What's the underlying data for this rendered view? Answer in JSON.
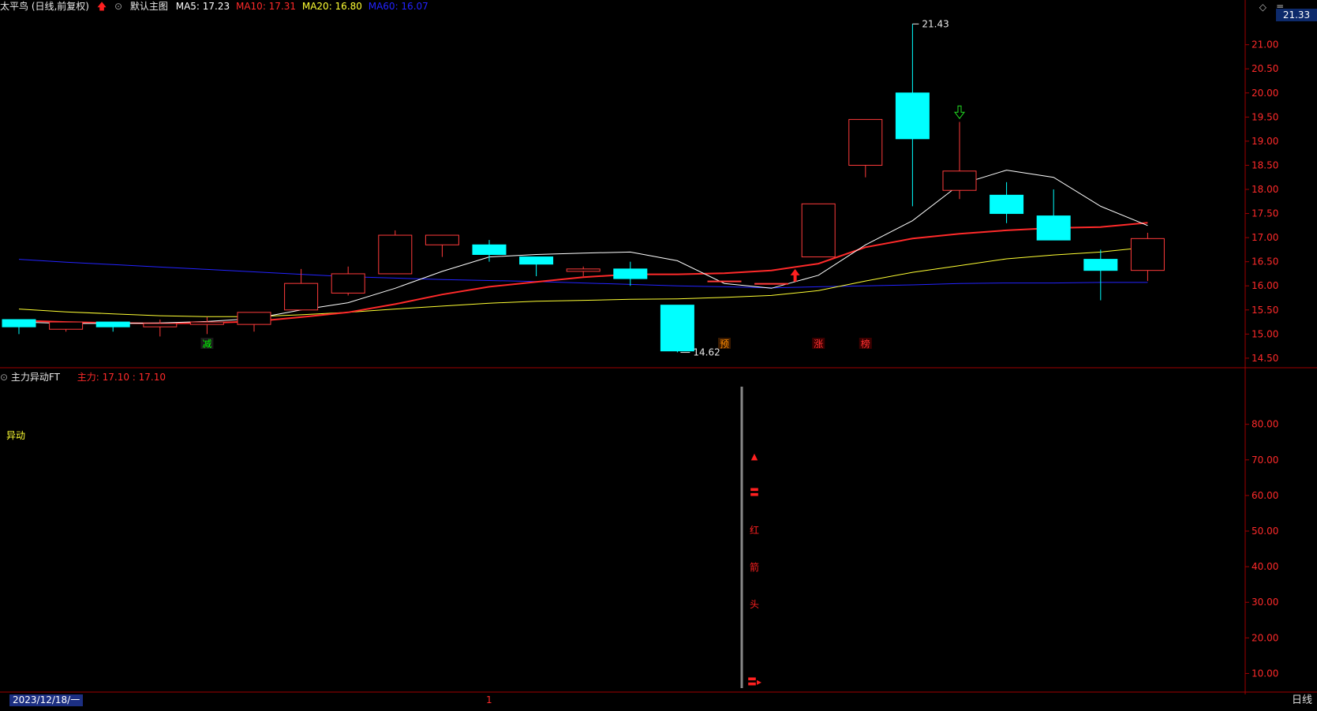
{
  "header": {
    "stock_title": "太平鸟 (日线,前复权)",
    "template_name": "默认主图",
    "ma": [
      {
        "label": "MA5: 17.23",
        "color": "#ffffff"
      },
      {
        "label": "MA10: 17.31",
        "color": "#ff2a2a"
      },
      {
        "label": "MA20: 16.80",
        "color": "#ffff33"
      },
      {
        "label": "MA60: 16.07",
        "color": "#2323ff"
      }
    ]
  },
  "window_controls": {
    "diamond": "◇",
    "menu": "≡",
    "settings": "◇"
  },
  "current_price_tag": "21.33",
  "price_axis": [
    "21.00",
    "20.50",
    "20.00",
    "19.50",
    "19.00",
    "18.50",
    "18.00",
    "17.50",
    "17.00",
    "16.50",
    "16.00",
    "15.50",
    "15.00",
    "14.50"
  ],
  "annotations": {
    "high": "21.43",
    "low": "14.62"
  },
  "signals": [
    {
      "text": "减",
      "color": "#00ff00",
      "bg": "#1a1a1a"
    },
    {
      "text": "预",
      "color": "#ff8c00",
      "bg": "#3a1a00"
    },
    {
      "text": "涨",
      "color": "#ff3030",
      "bg": "#3a0000"
    },
    {
      "text": "榜",
      "color": "#ff3030",
      "bg": "#3a0000"
    }
  ],
  "sub_chart": {
    "title": "主力异动FT",
    "value_text": "主力: 17.10 : 17.10",
    "label": "异动",
    "axis": [
      "80.00",
      "70.00",
      "60.00",
      "50.00",
      "40.00",
      "30.00",
      "20.00",
      "10.00"
    ],
    "marker_chars": [
      "▲",
      "〓",
      "红",
      "箭",
      "头",
      "〓▸"
    ]
  },
  "footer": {
    "date": "2023/12/18/一",
    "period": "日线",
    "mark": "1"
  },
  "chart_data": {
    "type": "candlestick",
    "ylim": [
      14.4,
      21.6
    ],
    "candles": [
      {
        "o": 15.15,
        "h": 15.3,
        "l": 15.0,
        "c": 15.3,
        "up": false
      },
      {
        "o": 15.1,
        "h": 15.25,
        "l": 15.05,
        "c": 15.25,
        "up": true
      },
      {
        "o": 15.15,
        "h": 15.25,
        "l": 15.05,
        "c": 15.25,
        "up": false
      },
      {
        "o": 15.15,
        "h": 15.3,
        "l": 14.95,
        "c": 15.22,
        "up": true
      },
      {
        "o": 15.2,
        "h": 15.35,
        "l": 15.0,
        "c": 15.25,
        "up": true
      },
      {
        "o": 15.2,
        "h": 15.45,
        "l": 15.05,
        "c": 15.45,
        "up": true
      },
      {
        "o": 15.5,
        "h": 16.35,
        "l": 15.5,
        "c": 16.05,
        "up": true
      },
      {
        "o": 15.85,
        "h": 16.4,
        "l": 15.8,
        "c": 16.25,
        "up": true
      },
      {
        "o": 16.25,
        "h": 17.15,
        "l": 16.25,
        "c": 17.05,
        "up": true
      },
      {
        "o": 16.85,
        "h": 17.05,
        "l": 16.6,
        "c": 17.05,
        "up": true
      },
      {
        "o": 16.85,
        "h": 16.95,
        "l": 16.5,
        "c": 16.65,
        "up": false
      },
      {
        "o": 16.6,
        "h": 16.6,
        "l": 16.2,
        "c": 16.45,
        "up": false
      },
      {
        "o": 16.3,
        "h": 16.4,
        "l": 16.2,
        "c": 16.35,
        "up": true
      },
      {
        "o": 16.35,
        "h": 16.5,
        "l": 16.0,
        "c": 16.15,
        "up": false
      },
      {
        "o": 15.6,
        "h": 15.6,
        "l": 14.62,
        "c": 14.65,
        "up": false
      },
      {
        "o": 16.1,
        "h": 16.1,
        "l": 16.1,
        "c": 16.1,
        "up": true
      },
      {
        "o": 16.05,
        "h": 16.05,
        "l": 16.05,
        "c": 16.05,
        "up": true
      },
      {
        "o": 16.6,
        "h": 17.7,
        "l": 16.6,
        "c": 17.7,
        "up": true
      },
      {
        "o": 18.5,
        "h": 19.45,
        "l": 18.25,
        "c": 19.45,
        "up": true
      },
      {
        "o": 20.0,
        "h": 21.43,
        "l": 17.65,
        "c": 19.05,
        "up": false
      },
      {
        "o": 17.98,
        "h": 19.4,
        "l": 17.8,
        "c": 18.38,
        "up": true
      },
      {
        "o": 17.88,
        "h": 18.15,
        "l": 17.3,
        "c": 17.5,
        "up": false
      },
      {
        "o": 17.45,
        "h": 18.0,
        "l": 16.95,
        "c": 16.95,
        "up": false
      },
      {
        "o": 16.55,
        "h": 16.75,
        "l": 15.7,
        "c": 16.32,
        "up": false
      },
      {
        "o": 16.32,
        "h": 17.1,
        "l": 16.1,
        "c": 16.98,
        "up": true
      }
    ],
    "ma5": [
      15.25,
      15.22,
      15.22,
      15.23,
      15.26,
      15.32,
      15.5,
      15.65,
      15.95,
      16.3,
      16.6,
      16.65,
      16.68,
      16.7,
      16.52,
      16.05,
      15.95,
      16.22,
      16.85,
      17.35,
      18.1,
      18.4,
      18.25,
      17.65,
      17.25
    ],
    "ma10": [
      15.28,
      15.25,
      15.23,
      15.22,
      15.23,
      15.26,
      15.35,
      15.45,
      15.62,
      15.82,
      15.98,
      16.08,
      16.18,
      16.24,
      16.24,
      16.26,
      16.32,
      16.46,
      16.8,
      16.98,
      17.08,
      17.15,
      17.2,
      17.22,
      17.31
    ],
    "ma20": [
      15.52,
      15.46,
      15.42,
      15.38,
      15.36,
      15.36,
      15.4,
      15.45,
      15.52,
      15.58,
      15.64,
      15.68,
      15.7,
      15.72,
      15.73,
      15.76,
      15.8,
      15.9,
      16.1,
      16.28,
      16.42,
      16.56,
      16.64,
      16.7,
      16.8
    ],
    "ma60": [
      16.55,
      16.49,
      16.44,
      16.39,
      16.34,
      16.29,
      16.24,
      16.19,
      16.16,
      16.13,
      16.11,
      16.09,
      16.06,
      16.03,
      16.0,
      15.98,
      15.96,
      15.98,
      16.0,
      16.02,
      16.05,
      16.06,
      16.06,
      16.07,
      16.07
    ]
  }
}
